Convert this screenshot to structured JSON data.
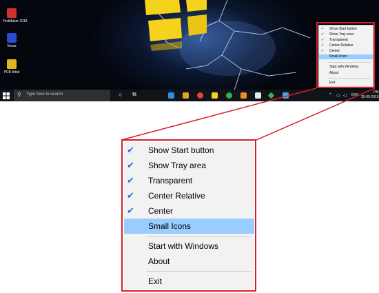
{
  "desktop": {
    "icons": [
      {
        "label": "TextMaker 2018",
        "icon": "textmaker-icon",
        "color": "#d0312d"
      },
      {
        "label": "Veusz",
        "icon": "veusz-icon",
        "color": "#2d4bd0"
      },
      {
        "label": "PCB Artist",
        "icon": "pcb-artist-icon",
        "color": "#e2b31a"
      }
    ]
  },
  "taskbar": {
    "search_placeholder": "Type here to search",
    "language": "ENG",
    "time": "PM",
    "date": "25-09-2019"
  },
  "menu": {
    "items": [
      {
        "label": "Show Start button",
        "checked": true,
        "highlighted": false
      },
      {
        "label": "Show Tray area",
        "checked": true,
        "highlighted": false
      },
      {
        "label": "Transparent",
        "checked": true,
        "highlighted": false
      },
      {
        "label": "Center Relative",
        "checked": true,
        "highlighted": false
      },
      {
        "label": "Center",
        "checked": true,
        "highlighted": false
      },
      {
        "label": "Small Icons",
        "checked": false,
        "highlighted": true
      }
    ],
    "items2": [
      {
        "label": "Start with Windows"
      },
      {
        "label": "About"
      }
    ],
    "items3": [
      {
        "label": "Exit"
      }
    ],
    "check_glyph": "✔"
  },
  "colors": {
    "highlight": "#99ccff",
    "frame": "#d3202a",
    "check": "#2b6fd6"
  }
}
